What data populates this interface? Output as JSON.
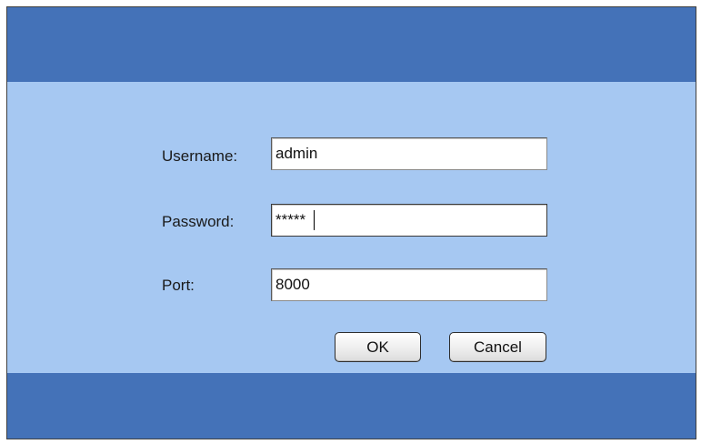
{
  "login": {
    "username_label": "Username:",
    "username_value": "admin",
    "password_label": "Password:",
    "password_value": "*****",
    "port_label": "Port:",
    "port_value": "8000",
    "ok_label": "OK",
    "cancel_label": "Cancel"
  },
  "colors": {
    "band": "#4472b8",
    "panel": "#a6c8f2"
  }
}
